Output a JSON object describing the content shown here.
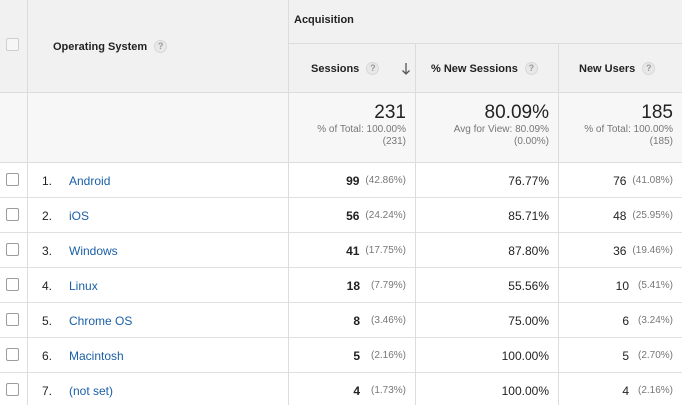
{
  "header": {
    "group_label": "Acquisition",
    "dimension_label": "Operating System",
    "columns": {
      "sessions": "Sessions",
      "new_sessions": "% New Sessions",
      "new_users": "New Users"
    },
    "help_glyph": "?"
  },
  "totals": {
    "sessions": {
      "value": "231",
      "line1": "% of Total: 100.00%",
      "line2": "(231)"
    },
    "new_sessions": {
      "value": "80.09%",
      "line1": "Avg for View: 80.09%",
      "line2": "(0.00%)"
    },
    "new_users": {
      "value": "185",
      "line1": "% of Total: 100.00%",
      "line2": "(185)"
    }
  },
  "rows": [
    {
      "idx": "1.",
      "os": "Android",
      "sessions": "99",
      "sessions_pct": "(42.86%)",
      "new_sessions": "76.77%",
      "new_users": "76",
      "new_users_pct": "(41.08%)"
    },
    {
      "idx": "2.",
      "os": "iOS",
      "sessions": "56",
      "sessions_pct": "(24.24%)",
      "new_sessions": "85.71%",
      "new_users": "48",
      "new_users_pct": "(25.95%)"
    },
    {
      "idx": "3.",
      "os": "Windows",
      "sessions": "41",
      "sessions_pct": "(17.75%)",
      "new_sessions": "87.80%",
      "new_users": "36",
      "new_users_pct": "(19.46%)"
    },
    {
      "idx": "4.",
      "os": "Linux",
      "sessions": "18",
      "sessions_pct": "(7.79%)",
      "new_sessions": "55.56%",
      "new_users": "10",
      "new_users_pct": "(5.41%)"
    },
    {
      "idx": "5.",
      "os": "Chrome OS",
      "sessions": "8",
      "sessions_pct": "(3.46%)",
      "new_sessions": "75.00%",
      "new_users": "6",
      "new_users_pct": "(3.24%)"
    },
    {
      "idx": "6.",
      "os": "Macintosh",
      "sessions": "5",
      "sessions_pct": "(2.16%)",
      "new_sessions": "100.00%",
      "new_users": "5",
      "new_users_pct": "(2.70%)"
    },
    {
      "idx": "7.",
      "os": "(not set)",
      "sessions": "4",
      "sessions_pct": "(1.73%)",
      "new_sessions": "100.00%",
      "new_users": "4",
      "new_users_pct": "(2.16%)"
    }
  ],
  "colors": {
    "link": "#1a5fa7",
    "header_bg": "#f1f1f1",
    "total_bg": "#f7f7f7",
    "border": "#dcdcdc"
  },
  "icons": {
    "sort": "arrow-down-icon",
    "help": "help-icon",
    "checkbox": "checkbox"
  }
}
